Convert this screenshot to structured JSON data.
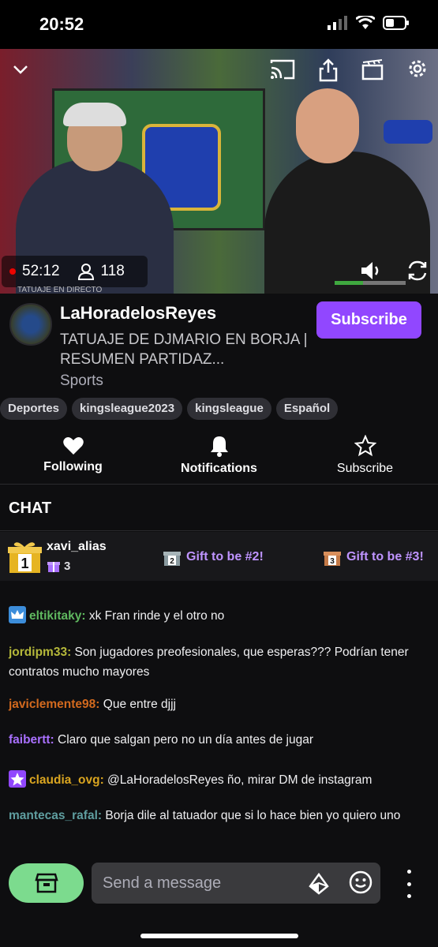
{
  "status_bar": {
    "time": "20:52"
  },
  "video": {
    "live_time": "52:12",
    "viewers": "118",
    "caption": "TATUAJE EN DIRECTO"
  },
  "channel": {
    "name": "LaHoradelosReyes",
    "title": "TATUAJE DE DJMARIO EN BORJA | RESUMEN PARTIDAZ...",
    "category": "Sports",
    "subscribe_label": "Subscribe"
  },
  "tags": [
    "Deportes",
    "kingsleague2023",
    "kingsleague",
    "Español"
  ],
  "actions": [
    {
      "label": "Following",
      "icon": "heart-icon"
    },
    {
      "label": "Notifications",
      "icon": "bell-icon"
    },
    {
      "label": "Subscribe",
      "icon": "star-icon"
    }
  ],
  "chat": {
    "header": "CHAT",
    "gift_leader": {
      "rank": "1",
      "user": "xavi_alias",
      "count": "3"
    },
    "gift_slots": [
      {
        "rank": "2",
        "label": "Gift to be #2!"
      },
      {
        "rank": "3",
        "label": "Gift to be #3!"
      }
    ],
    "messages": [
      {
        "user": "eltikitaky:",
        "text": " xk Fran rinde y el otro no",
        "color": "#5fb85f",
        "badge": "crown"
      },
      {
        "user": "jordipm33:",
        "text": " Son jugadores preofesionales, que esperas??? Podrían tener contratos mucho mayores",
        "color": "#b5b83a",
        "badge": ""
      },
      {
        "user": "javiclemente98:",
        "text": " Que entre djjj",
        "color": "#d2691e",
        "badge": ""
      },
      {
        "user": "faibertt:",
        "text": " Claro que salgan pero no un día antes de jugar",
        "color": "#a970ff",
        "badge": ""
      },
      {
        "user": "claudia_ovg:",
        "text": " @LaHoradelosReyes ño, mirar DM de instagram",
        "color": "#daa520",
        "badge": "star"
      },
      {
        "user": "mantecas_rafal:",
        "text": " Borja dile al tatuador que si lo hace bien yo quiero uno",
        "color": "#5f9ea0",
        "badge": ""
      }
    ],
    "input_placeholder": "Send a message"
  },
  "colors": {
    "accent": "#9147ff",
    "store": "#7cdb8e",
    "live": "#eb0400"
  }
}
